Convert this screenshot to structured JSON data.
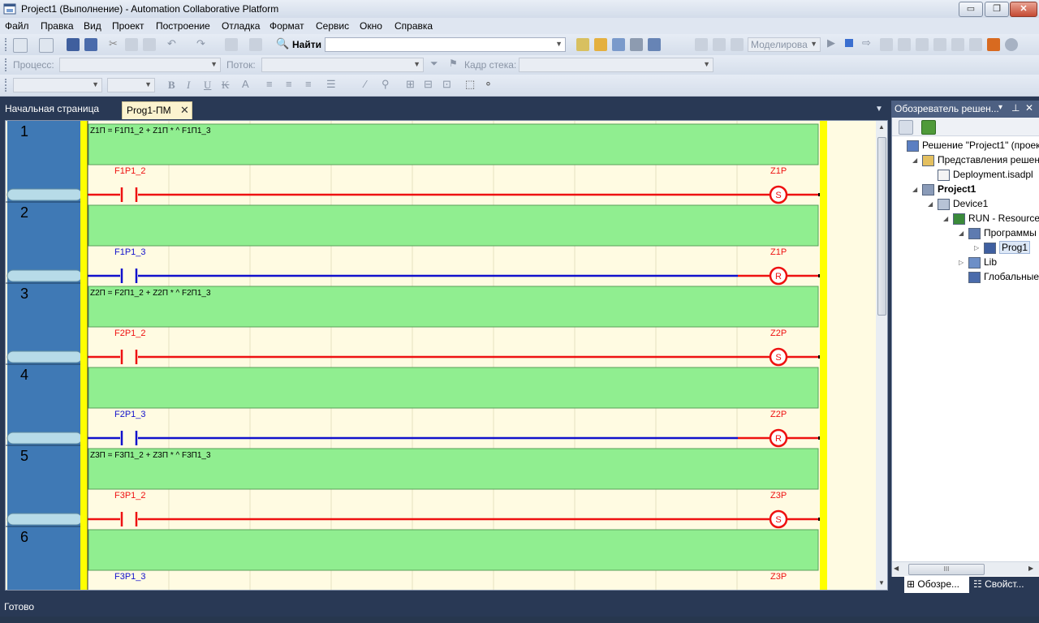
{
  "window": {
    "title": "Project1 (Выполнение) - Automation Collaborative Platform",
    "buttons": {
      "minimize": "▭",
      "restore": "❐",
      "close": "✕"
    }
  },
  "menu": [
    "Файл",
    "Правка",
    "Вид",
    "Проект",
    "Построение",
    "Отладка",
    "Формат",
    "Сервис",
    "Окно",
    "Справка"
  ],
  "toolbar1": {
    "find_label": "Найти",
    "find_value": "",
    "mode_value": "Моделирова"
  },
  "toolbar2": {
    "process_label": "Процесс:",
    "thread_label": "Поток:",
    "stack_label": "Кадр стека:"
  },
  "toolbar3": {
    "bold": "B",
    "italic": "I",
    "underline": "U",
    "strike": "K"
  },
  "tabs": {
    "start_page": "Начальная страница",
    "active": "Prog1-ПМ",
    "close": "✕"
  },
  "ladder": {
    "rungs": [
      {
        "number": "1",
        "comment": "Z1П = F1П1_2 + Z1П * ^ F1П1_3",
        "contact": "F1P1_2",
        "coil": "Z1P",
        "coil_type": "S",
        "energized": true
      },
      {
        "number": "2",
        "comment": "",
        "contact": "F1P1_3",
        "coil": "Z1P",
        "coil_type": "R",
        "energized": false
      },
      {
        "number": "3",
        "comment": "Z2П = F2П1_2 + Z2П * ^ F2П1_3",
        "contact": "F2P1_2",
        "coil": "Z2P",
        "coil_type": "S",
        "energized": true
      },
      {
        "number": "4",
        "comment": "",
        "contact": "F2P1_3",
        "coil": "Z2P",
        "coil_type": "R",
        "energized": false
      },
      {
        "number": "5",
        "comment": "Z3П = F3П1_2 + Z3П * ^ F3П1_3",
        "contact": "F3P1_2",
        "coil": "Z3P",
        "coil_type": "S",
        "energized": true
      },
      {
        "number": "6",
        "comment": "",
        "contact": "F3P1_3",
        "coil": "Z3P",
        "coil_type": "R",
        "energized": false
      }
    ],
    "colors": {
      "rail": "#ffff00",
      "gutter": "#3f79b5",
      "comment_bg": "#90ee90",
      "energized": "#ee1111",
      "deenergized": "#1111cc",
      "background": "#fffbe2"
    }
  },
  "solution_explorer": {
    "title": "Обозреватель решен...",
    "header_buttons": {
      "dropdown": "▾",
      "pin": "⊥",
      "close": "✕"
    },
    "tree": [
      {
        "label": "Решение \"Project1\"  (проект",
        "bold": false,
        "expander": "",
        "icon": "solution-icon"
      },
      {
        "label": "Представления решен",
        "bold": false,
        "expander": "◢",
        "icon": "folder-icon"
      },
      {
        "label": "Deployment.isadpl",
        "bold": false,
        "expander": "",
        "icon": "file-icon"
      },
      {
        "label": "Project1",
        "bold": true,
        "expander": "◢",
        "icon": "project-icon"
      },
      {
        "label": "Device1",
        "bold": false,
        "expander": "◢",
        "icon": "device-icon"
      },
      {
        "label": "RUN - Resource",
        "bold": false,
        "expander": "◢",
        "icon": "resource-icon"
      },
      {
        "label": "Программы",
        "bold": false,
        "expander": "◢",
        "icon": "programs-icon"
      },
      {
        "label": "Prog1",
        "bold": false,
        "expander": "▷",
        "icon": "program-icon",
        "selected": true
      },
      {
        "label": "Lib",
        "bold": false,
        "expander": "▷",
        "icon": "library-icon"
      },
      {
        "label": "Глобальные",
        "bold": false,
        "expander": "",
        "icon": "globals-icon"
      }
    ],
    "hscroll_grip": "III"
  },
  "bottom_tabs": {
    "explorer": "Обозре...",
    "properties": "Свойст..."
  },
  "status": {
    "text": "Готово"
  }
}
